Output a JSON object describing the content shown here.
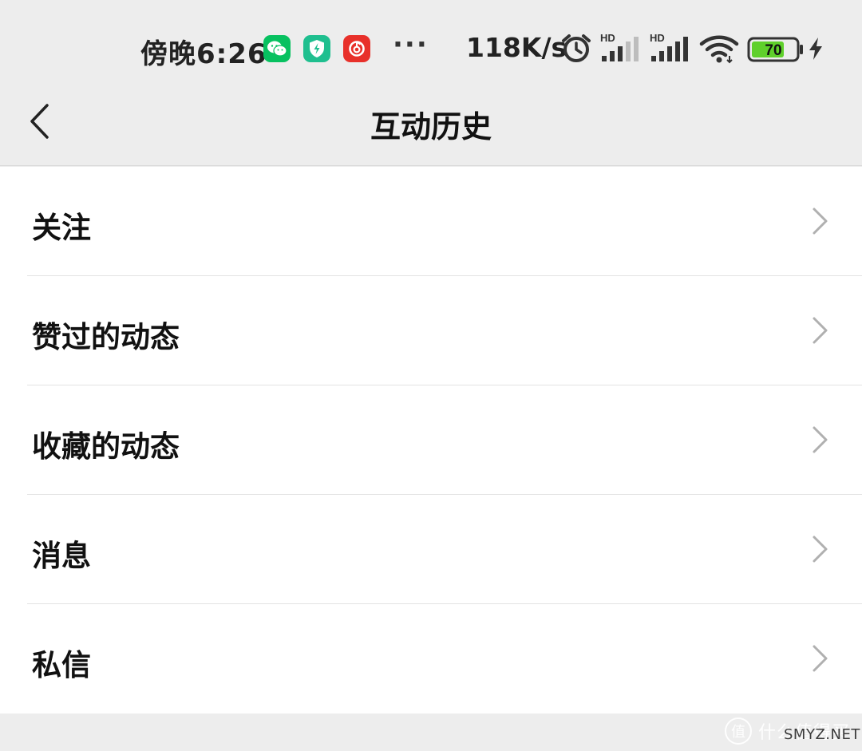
{
  "status_bar": {
    "time": "傍晚6:26",
    "notification_icons": [
      "wechat-icon",
      "shield-icon",
      "netease-music-icon"
    ],
    "overflow": "···",
    "net_speed": "118K/s",
    "signal_label_1": "HD",
    "signal_label_2": "HD",
    "battery_level": "70",
    "colors": {
      "wechat": "#07c160",
      "shield": "#1fbf8f",
      "music": "#e8302a",
      "battery": "#5fd02b"
    }
  },
  "nav": {
    "title": "互动历史"
  },
  "list": {
    "items": [
      {
        "label": "关注"
      },
      {
        "label": "赞过的动态"
      },
      {
        "label": "收藏的动态"
      },
      {
        "label": "消息"
      },
      {
        "label": "私信"
      }
    ]
  },
  "watermark": {
    "badge": "值",
    "text": "什么值得买",
    "site": "SMYZ.NET"
  }
}
